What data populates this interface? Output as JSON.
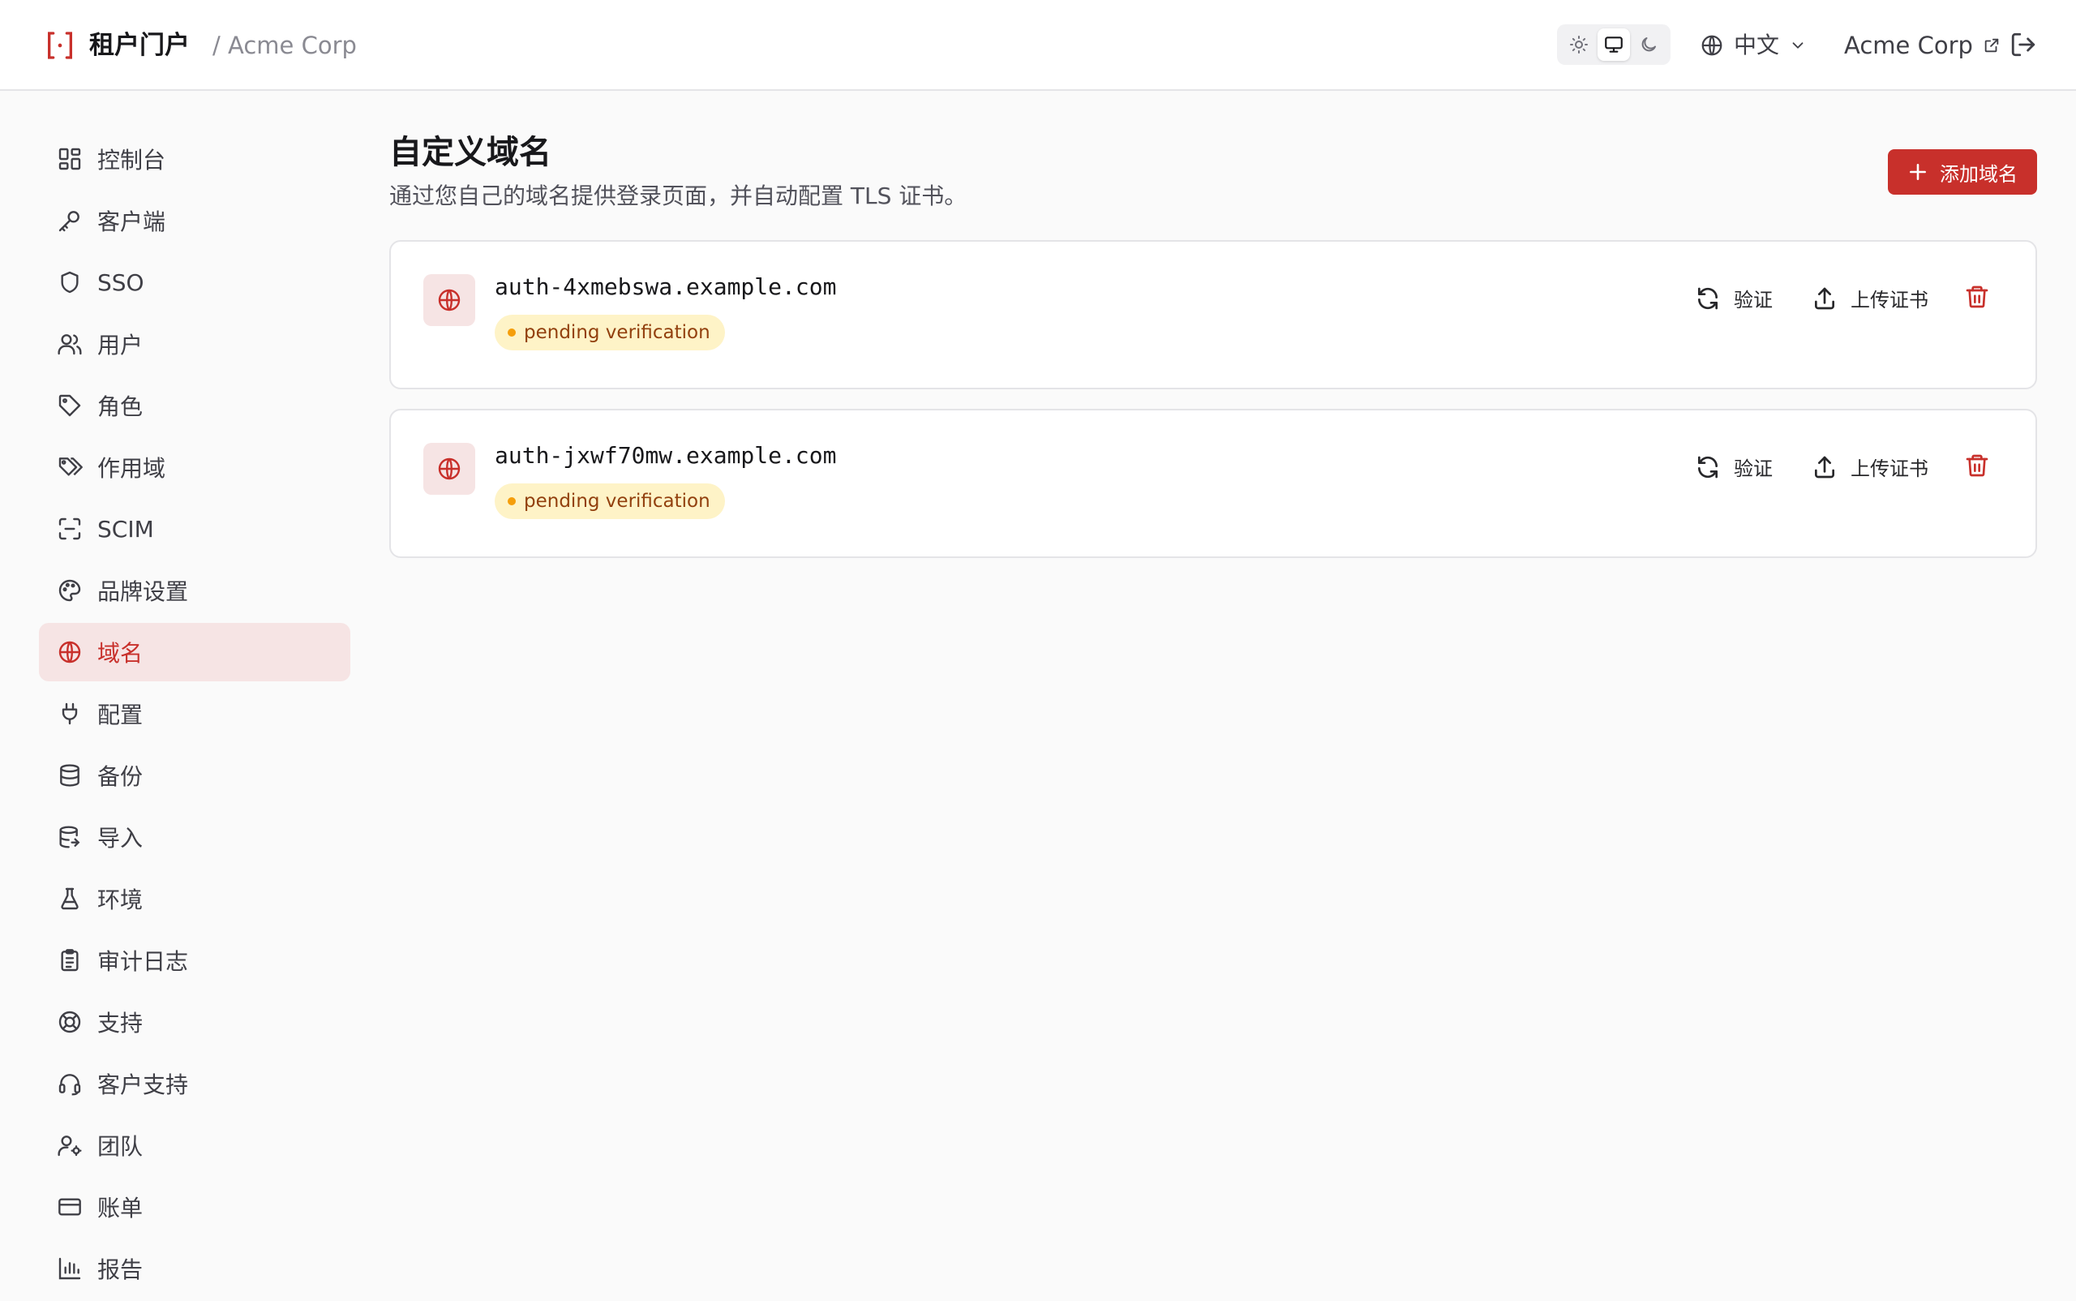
{
  "header": {
    "app_title": "租户门户",
    "breadcrumb": "/ Acme Corp",
    "language": "中文",
    "org_name": "Acme Corp",
    "theme_active": "system"
  },
  "sidebar": {
    "items": [
      {
        "label": "控制台",
        "icon": "dashboard-icon"
      },
      {
        "label": "客户端",
        "icon": "key-icon"
      },
      {
        "label": "SSO",
        "icon": "shield-icon"
      },
      {
        "label": "用户",
        "icon": "users-icon"
      },
      {
        "label": "角色",
        "icon": "tag-icon"
      },
      {
        "label": "作用域",
        "icon": "tags-icon"
      },
      {
        "label": "SCIM",
        "icon": "scan-icon"
      },
      {
        "label": "品牌设置",
        "icon": "palette-icon"
      },
      {
        "label": "域名",
        "icon": "globe-icon",
        "active": true
      },
      {
        "label": "配置",
        "icon": "plug-icon"
      },
      {
        "label": "备份",
        "icon": "database-icon"
      },
      {
        "label": "导入",
        "icon": "database-import-icon"
      },
      {
        "label": "环境",
        "icon": "flask-icon"
      },
      {
        "label": "审计日志",
        "icon": "clipboard-icon"
      },
      {
        "label": "支持",
        "icon": "lifebuoy-icon"
      },
      {
        "label": "客户支持",
        "icon": "headset-icon"
      },
      {
        "label": "团队",
        "icon": "user-cog-icon"
      },
      {
        "label": "账单",
        "icon": "credit-card-icon"
      },
      {
        "label": "报告",
        "icon": "bar-chart-icon"
      }
    ]
  },
  "main": {
    "title": "自定义域名",
    "subtitle": "通过您自己的域名提供登录页面，并自动配置 TLS 证书。",
    "add_button": "添加域名",
    "domains": [
      {
        "name": "auth-4xmebswa.example.com",
        "status": "pending verification"
      },
      {
        "name": "auth-jxwf70mw.example.com",
        "status": "pending verification"
      }
    ],
    "actions": {
      "verify": "验证",
      "upload_cert": "上传证书"
    }
  },
  "colors": {
    "accent": "#c8302b",
    "accent_soft": "#f6e4e4",
    "pending_bg": "#fef3c7",
    "pending_dot": "#f59e0b"
  }
}
